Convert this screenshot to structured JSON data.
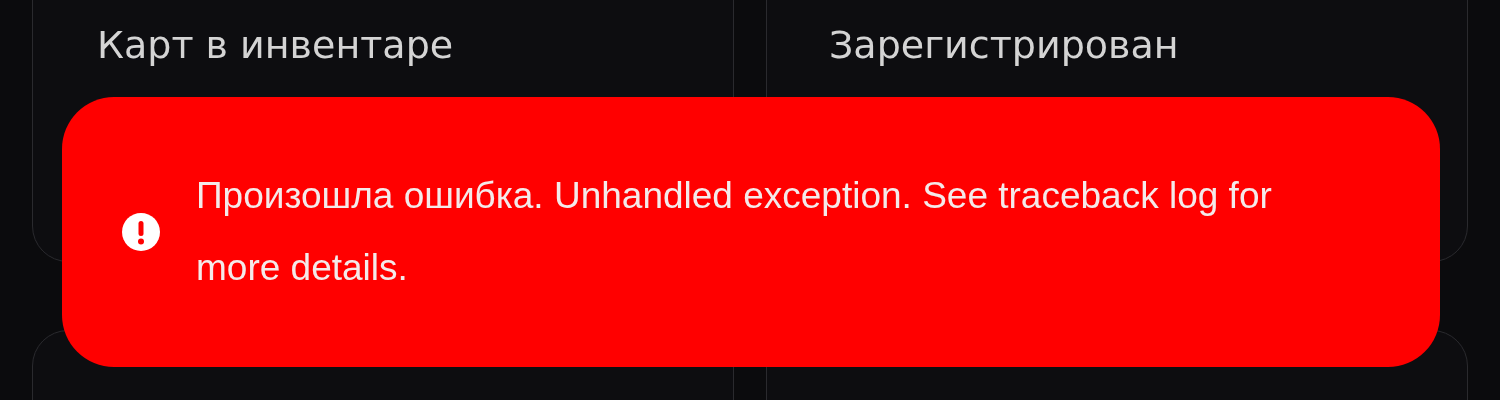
{
  "cards": [
    {
      "label": "Карт в инвентаре"
    },
    {
      "label": "Зарегистрирован"
    }
  ],
  "toast": {
    "kind": "error",
    "message": "Произошла ошибка. Unhandled exception. See traceback log for more details."
  }
}
